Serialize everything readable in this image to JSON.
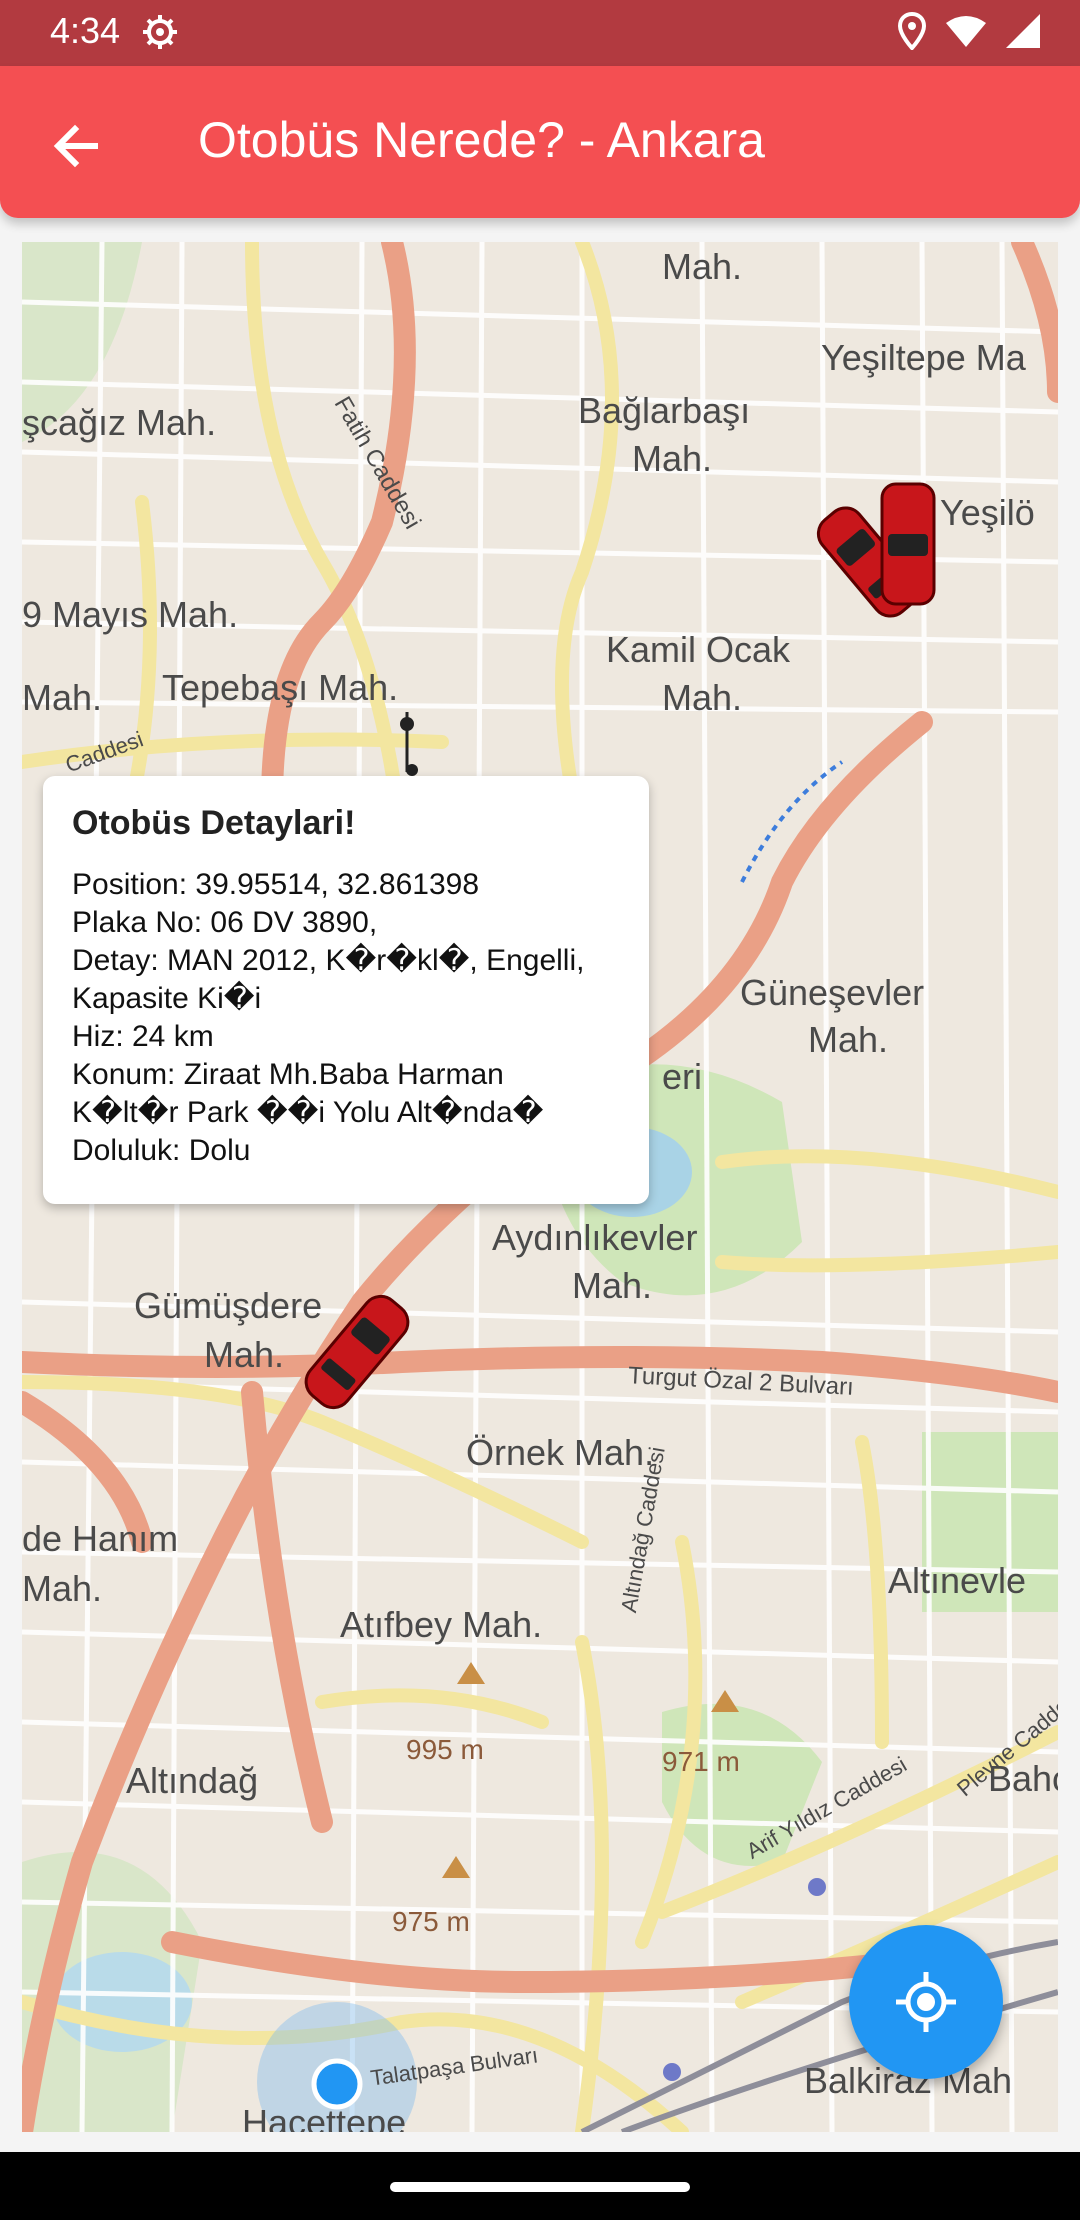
{
  "status_bar": {
    "time": "4:34"
  },
  "app_bar": {
    "title": "Otobüs Nerede? - Ankara"
  },
  "map": {
    "labels": [
      "Mah.",
      "Yeşiltepe Ma",
      "şcağız Mah.",
      "Bağlarbaşı",
      "Mah.",
      "Yeşilö",
      "9 Mayıs Mah.",
      "Kamil Ocak",
      "Mah.",
      "Mah.",
      "Tepebaşı Mah.",
      "Güneşevler",
      "Mah.",
      "Aydınlıkevler",
      "Mah.",
      "Gümüşdere",
      "Mah.",
      "Örnek Mah.",
      "de Hanım",
      "Mah.",
      "Altınevle",
      "Atıfbey Mah.",
      "Altındağ",
      "Bahçe",
      "Balkiraz Mah",
      "Hacettepe",
      "eri",
      "Fatih Caddesi",
      "Turgut Özal 2 Bulvarı",
      "Altındağ Caddesi",
      "Arif Yıldız Caddesi",
      "Plevne Caddesi",
      "Talatpaşa Bulvarı",
      "Caddesi",
      "995 m",
      "971 m",
      "975 m"
    ]
  },
  "popup": {
    "title": "Otobüs Detaylari!",
    "body": "Position: 39.95514, 32.861398\nPlaka No: 06 DV 3890,\nDetay: MAN 2012, K�r�kl�, Engelli,\nKapasite  Ki�i\nHiz: 24 km\nKonum: Ziraat Mh.Baba Harman\nK�lt�r Park ��i Yolu Alt�nda�\nDoluluk: Dolu"
  },
  "icons": {
    "back": "arrow-back-icon",
    "location": "my-location-icon",
    "bus": "red-car-marker-icon"
  },
  "colors": {
    "status_bar": "#b23a40",
    "app_bar": "#f44f52",
    "fab": "#2196f3"
  }
}
